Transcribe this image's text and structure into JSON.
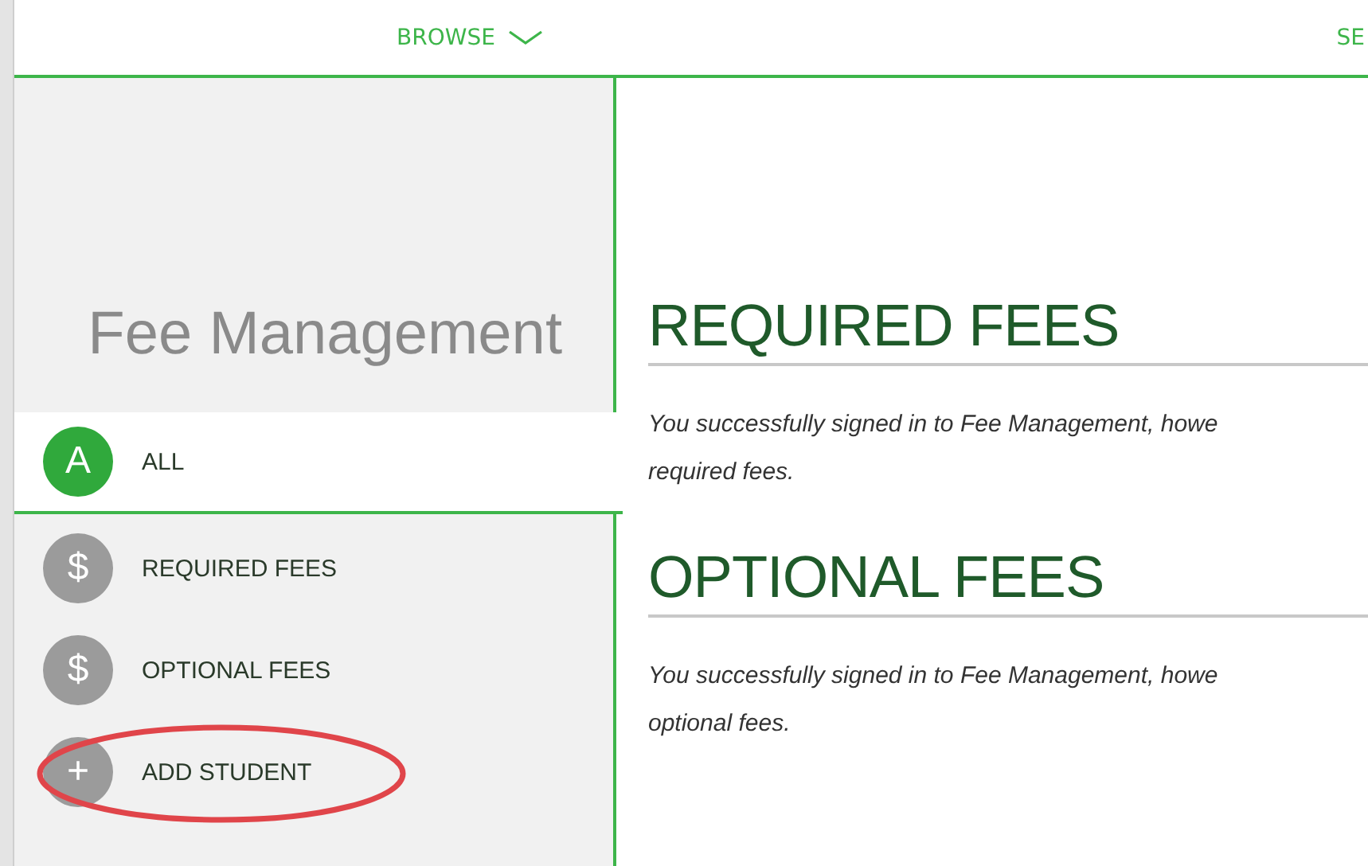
{
  "nav": {
    "items": [
      {
        "label": "BROWSE",
        "dropdown": true
      },
      {
        "label": "SE",
        "dropdown": false
      }
    ]
  },
  "sidebar": {
    "title": "Fee Management",
    "items": [
      {
        "label": "ALL",
        "icon": "A",
        "kind": "letter",
        "selected": true,
        "highlighted": false
      },
      {
        "label": "REQUIRED FEES",
        "icon": "$",
        "kind": "letter",
        "selected": false,
        "highlighted": false
      },
      {
        "label": "OPTIONAL FEES",
        "icon": "$",
        "kind": "letter",
        "selected": false,
        "highlighted": false
      },
      {
        "label": "ADD STUDENT",
        "icon": "+",
        "kind": "letter",
        "selected": false,
        "highlighted": true
      }
    ]
  },
  "sections": [
    {
      "heading": "REQUIRED FEES",
      "lines": [
        "You successfully signed in to Fee Management, howe",
        "required fees."
      ]
    },
    {
      "heading": "OPTIONAL FEES",
      "lines": [
        "You successfully signed in to Fee Management, howe",
        "optional fees."
      ]
    }
  ]
}
